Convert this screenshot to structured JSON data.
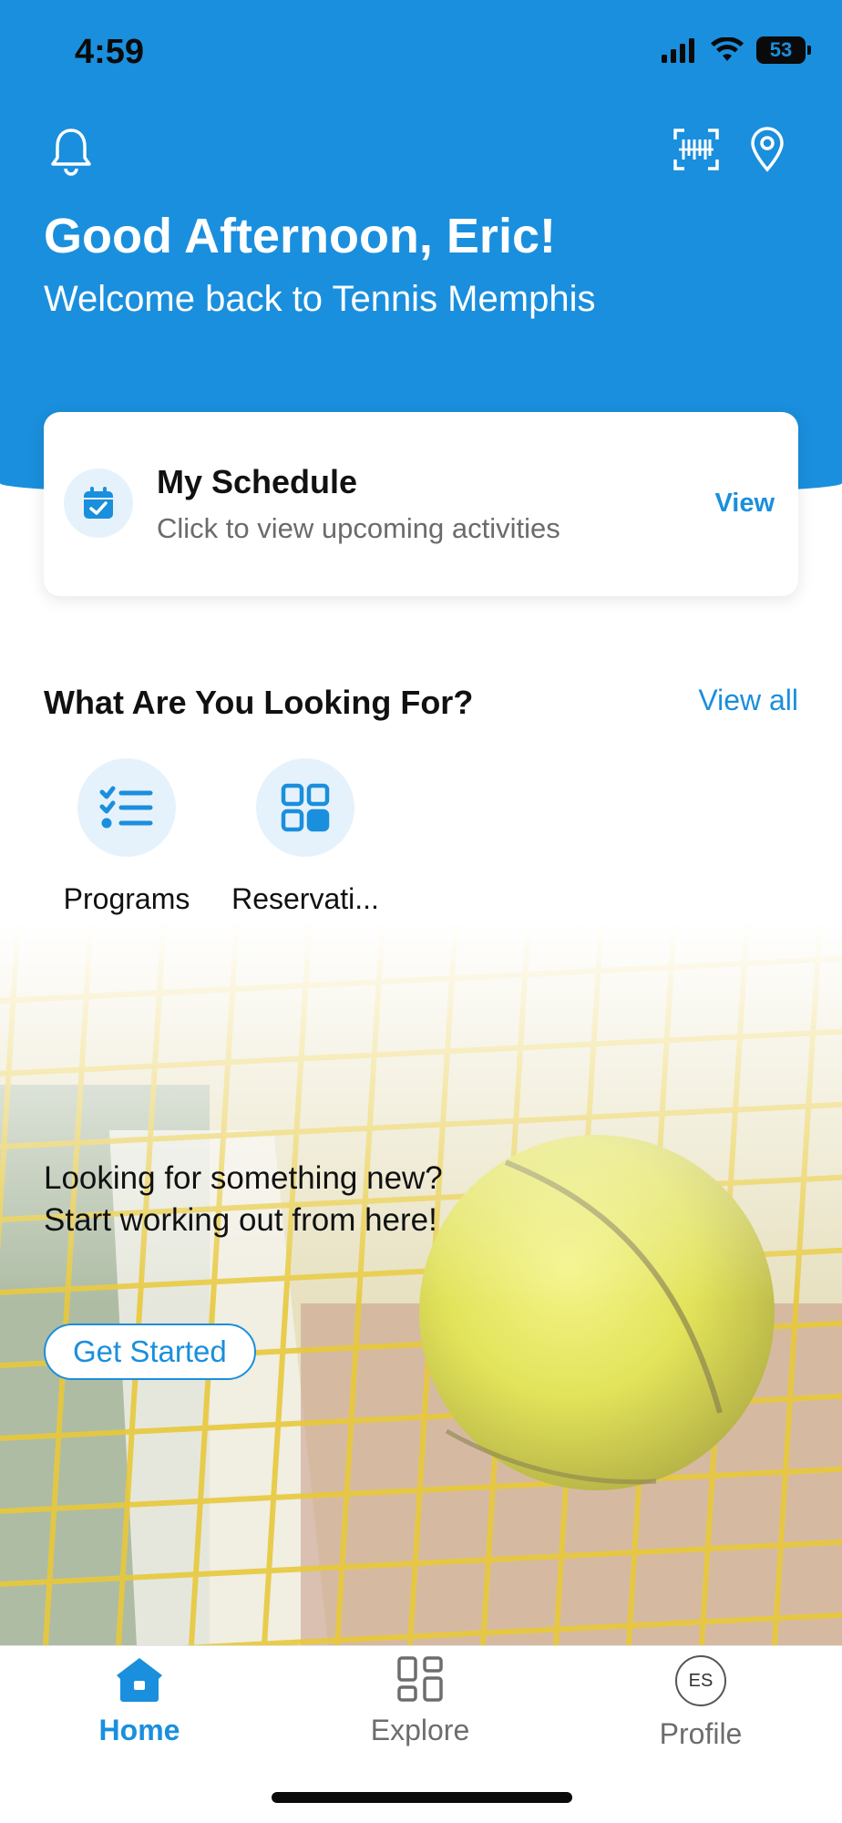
{
  "status_bar": {
    "time": "4:59",
    "battery_level": "53"
  },
  "header": {
    "greeting": "Good Afternoon, Eric!",
    "welcome": "Welcome back to Tennis Memphis",
    "icons": [
      "bell-icon",
      "barcode-icon",
      "location-pin-icon"
    ]
  },
  "schedule": {
    "title": "My Schedule",
    "subtitle": "Click to view upcoming activities",
    "action": "View"
  },
  "categories": {
    "title": "What Are You Looking For?",
    "view_all": "View all",
    "items": [
      {
        "label": "Programs",
        "icon": "checklist-icon"
      },
      {
        "label": "Reservati...",
        "icon": "grid-icon"
      }
    ]
  },
  "banner": {
    "line1": "Looking for something new?",
    "line2": "Start working out from here!",
    "cta": "Get Started"
  },
  "tabs": {
    "items": [
      {
        "label": "Home",
        "icon": "home-icon",
        "active": true
      },
      {
        "label": "Explore",
        "icon": "grid-icon",
        "active": false
      },
      {
        "label": "Profile",
        "icon": "avatar",
        "initials": "ES",
        "active": false
      }
    ]
  },
  "colors": {
    "accent": "#1a8fdd",
    "header_bg": "#1a8fdd",
    "icon_circle_bg": "#e6f2fb"
  }
}
